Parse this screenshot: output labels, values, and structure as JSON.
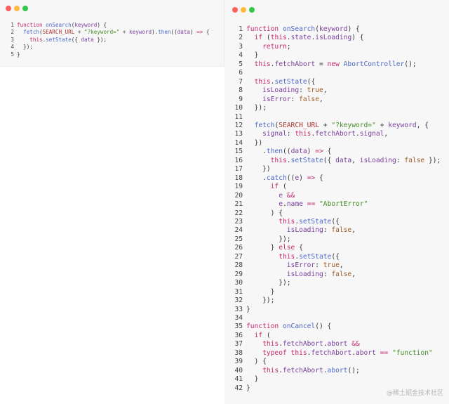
{
  "colors": {
    "dot_close": "#fc615d",
    "dot_minimize": "#fdbc40",
    "dot_zoom": "#34c84a",
    "keyword": "#c5286d",
    "function_name": "#4b69c6",
    "string": "#448c27",
    "constant": "#aa3731",
    "boolean": "#9c5d27",
    "property": "#7a3e9d",
    "plain": "#333333",
    "line_number": "#424242"
  },
  "left_editor": {
    "lines": [
      [
        {
          "t": "function",
          "c": "k"
        },
        {
          "t": " "
        },
        {
          "t": "onSearch",
          "c": "f"
        },
        {
          "t": "("
        },
        {
          "t": "keyword",
          "c": "p"
        },
        {
          "t": ") {"
        }
      ],
      [
        {
          "t": "  "
        },
        {
          "t": "fetch",
          "c": "f"
        },
        {
          "t": "("
        },
        {
          "t": "SEARCH_URL",
          "c": "c"
        },
        {
          "t": " + "
        },
        {
          "t": "\"?keyword=\"",
          "c": "s"
        },
        {
          "t": " + "
        },
        {
          "t": "keyword",
          "c": "p"
        },
        {
          "t": ")."
        },
        {
          "t": "then",
          "c": "f"
        },
        {
          "t": "(("
        },
        {
          "t": "data",
          "c": "p"
        },
        {
          "t": ") "
        },
        {
          "t": "=>",
          "c": "k"
        },
        {
          "t": " {"
        }
      ],
      [
        {
          "t": "    "
        },
        {
          "t": "this",
          "c": "k"
        },
        {
          "t": "."
        },
        {
          "t": "setState",
          "c": "f"
        },
        {
          "t": "({ "
        },
        {
          "t": "data",
          "c": "p"
        },
        {
          "t": " });"
        }
      ],
      [
        {
          "t": "  });"
        }
      ],
      [
        {
          "t": "}"
        }
      ]
    ]
  },
  "right_editor": {
    "lines": [
      [
        {
          "t": "function",
          "c": "k"
        },
        {
          "t": " "
        },
        {
          "t": "onSearch",
          "c": "f"
        },
        {
          "t": "("
        },
        {
          "t": "keyword",
          "c": "p"
        },
        {
          "t": ") {"
        }
      ],
      [
        {
          "t": "  "
        },
        {
          "t": "if",
          "c": "k"
        },
        {
          "t": " ("
        },
        {
          "t": "this",
          "c": "k"
        },
        {
          "t": "."
        },
        {
          "t": "state",
          "c": "p"
        },
        {
          "t": "."
        },
        {
          "t": "isLoading",
          "c": "p"
        },
        {
          "t": ") {"
        }
      ],
      [
        {
          "t": "    "
        },
        {
          "t": "return",
          "c": "k"
        },
        {
          "t": ";"
        }
      ],
      [
        {
          "t": "  }"
        }
      ],
      [
        {
          "t": "  "
        },
        {
          "t": "this",
          "c": "k"
        },
        {
          "t": "."
        },
        {
          "t": "fetchAbort",
          "c": "p"
        },
        {
          "t": " = "
        },
        {
          "t": "new",
          "c": "k"
        },
        {
          "t": " "
        },
        {
          "t": "AbortController",
          "c": "f"
        },
        {
          "t": "();"
        }
      ],
      [],
      [
        {
          "t": "  "
        },
        {
          "t": "this",
          "c": "k"
        },
        {
          "t": "."
        },
        {
          "t": "setState",
          "c": "f"
        },
        {
          "t": "({"
        }
      ],
      [
        {
          "t": "    "
        },
        {
          "t": "isLoading",
          "c": "p"
        },
        {
          "t": ": "
        },
        {
          "t": "true",
          "c": "b"
        },
        {
          "t": ","
        }
      ],
      [
        {
          "t": "    "
        },
        {
          "t": "isError",
          "c": "p"
        },
        {
          "t": ": "
        },
        {
          "t": "false",
          "c": "b"
        },
        {
          "t": ","
        }
      ],
      [
        {
          "t": "  });"
        }
      ],
      [],
      [
        {
          "t": "  "
        },
        {
          "t": "fetch",
          "c": "f"
        },
        {
          "t": "("
        },
        {
          "t": "SEARCH_URL",
          "c": "c"
        },
        {
          "t": " + "
        },
        {
          "t": "\"?keyword=\"",
          "c": "s"
        },
        {
          "t": " + "
        },
        {
          "t": "keyword",
          "c": "p"
        },
        {
          "t": ", {"
        }
      ],
      [
        {
          "t": "    "
        },
        {
          "t": "signal",
          "c": "p"
        },
        {
          "t": ": "
        },
        {
          "t": "this",
          "c": "k"
        },
        {
          "t": "."
        },
        {
          "t": "fetchAbort",
          "c": "p"
        },
        {
          "t": "."
        },
        {
          "t": "signal",
          "c": "p"
        },
        {
          "t": ","
        }
      ],
      [
        {
          "t": "  })"
        }
      ],
      [
        {
          "t": "    ."
        },
        {
          "t": "then",
          "c": "f"
        },
        {
          "t": "(("
        },
        {
          "t": "data",
          "c": "p"
        },
        {
          "t": ") "
        },
        {
          "t": "=>",
          "c": "k"
        },
        {
          "t": " {"
        }
      ],
      [
        {
          "t": "      "
        },
        {
          "t": "this",
          "c": "k"
        },
        {
          "t": "."
        },
        {
          "t": "setState",
          "c": "f"
        },
        {
          "t": "({ "
        },
        {
          "t": "data",
          "c": "p"
        },
        {
          "t": ", "
        },
        {
          "t": "isLoading",
          "c": "p"
        },
        {
          "t": ": "
        },
        {
          "t": "false",
          "c": "b"
        },
        {
          "t": " });"
        }
      ],
      [
        {
          "t": "    })"
        }
      ],
      [
        {
          "t": "    ."
        },
        {
          "t": "catch",
          "c": "f"
        },
        {
          "t": "(("
        },
        {
          "t": "e",
          "c": "p"
        },
        {
          "t": ") "
        },
        {
          "t": "=>",
          "c": "k"
        },
        {
          "t": " {"
        }
      ],
      [
        {
          "t": "      "
        },
        {
          "t": "if",
          "c": "k"
        },
        {
          "t": " ("
        }
      ],
      [
        {
          "t": "        "
        },
        {
          "t": "e",
          "c": "p"
        },
        {
          "t": " "
        },
        {
          "t": "&&",
          "c": "k"
        }
      ],
      [
        {
          "t": "        "
        },
        {
          "t": "e",
          "c": "p"
        },
        {
          "t": "."
        },
        {
          "t": "name",
          "c": "p"
        },
        {
          "t": " "
        },
        {
          "t": "==",
          "c": "k"
        },
        {
          "t": " "
        },
        {
          "t": "\"AbortError\"",
          "c": "s"
        }
      ],
      [
        {
          "t": "      ) {"
        }
      ],
      [
        {
          "t": "        "
        },
        {
          "t": "this",
          "c": "k"
        },
        {
          "t": "."
        },
        {
          "t": "setState",
          "c": "f"
        },
        {
          "t": "({"
        }
      ],
      [
        {
          "t": "          "
        },
        {
          "t": "isLoading",
          "c": "p"
        },
        {
          "t": ": "
        },
        {
          "t": "false",
          "c": "b"
        },
        {
          "t": ","
        }
      ],
      [
        {
          "t": "        });"
        }
      ],
      [
        {
          "t": "      } "
        },
        {
          "t": "else",
          "c": "k"
        },
        {
          "t": " {"
        }
      ],
      [
        {
          "t": "        "
        },
        {
          "t": "this",
          "c": "k"
        },
        {
          "t": "."
        },
        {
          "t": "setState",
          "c": "f"
        },
        {
          "t": "({"
        }
      ],
      [
        {
          "t": "          "
        },
        {
          "t": "isError",
          "c": "p"
        },
        {
          "t": ": "
        },
        {
          "t": "true",
          "c": "b"
        },
        {
          "t": ","
        }
      ],
      [
        {
          "t": "          "
        },
        {
          "t": "isLoading",
          "c": "p"
        },
        {
          "t": ": "
        },
        {
          "t": "false",
          "c": "b"
        },
        {
          "t": ","
        }
      ],
      [
        {
          "t": "        });"
        }
      ],
      [
        {
          "t": "      }"
        }
      ],
      [
        {
          "t": "    });"
        }
      ],
      [
        {
          "t": "}"
        }
      ],
      [],
      [
        {
          "t": "function",
          "c": "k"
        },
        {
          "t": " "
        },
        {
          "t": "onCancel",
          "c": "f"
        },
        {
          "t": "() {"
        }
      ],
      [
        {
          "t": "  "
        },
        {
          "t": "if",
          "c": "k"
        },
        {
          "t": " ("
        }
      ],
      [
        {
          "t": "    "
        },
        {
          "t": "this",
          "c": "k"
        },
        {
          "t": "."
        },
        {
          "t": "fetchAbort",
          "c": "p"
        },
        {
          "t": "."
        },
        {
          "t": "abort",
          "c": "p"
        },
        {
          "t": " "
        },
        {
          "t": "&&",
          "c": "k"
        }
      ],
      [
        {
          "t": "    "
        },
        {
          "t": "typeof",
          "c": "k"
        },
        {
          "t": " "
        },
        {
          "t": "this",
          "c": "k"
        },
        {
          "t": "."
        },
        {
          "t": "fetchAbort",
          "c": "p"
        },
        {
          "t": "."
        },
        {
          "t": "abort",
          "c": "p"
        },
        {
          "t": " "
        },
        {
          "t": "==",
          "c": "k"
        },
        {
          "t": " "
        },
        {
          "t": "\"function\"",
          "c": "s"
        }
      ],
      [
        {
          "t": "  ) {"
        }
      ],
      [
        {
          "t": "    "
        },
        {
          "t": "this",
          "c": "k"
        },
        {
          "t": "."
        },
        {
          "t": "fetchAbort",
          "c": "p"
        },
        {
          "t": "."
        },
        {
          "t": "abort",
          "c": "f"
        },
        {
          "t": "();"
        }
      ],
      [
        {
          "t": "  }"
        }
      ],
      [
        {
          "t": "}"
        }
      ]
    ]
  },
  "watermark": "@稀土掘金技术社区"
}
